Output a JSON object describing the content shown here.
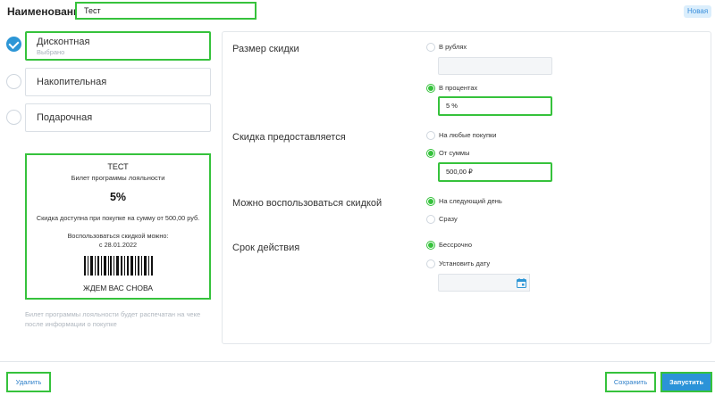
{
  "header": {
    "name_label": "Наименование",
    "name_value": "Тест",
    "status_badge": "Новая"
  },
  "types": [
    {
      "label": "Дисконтная",
      "sub": "Выбрано",
      "selected": true
    },
    {
      "label": "Накопительная",
      "selected": false
    },
    {
      "label": "Подарочная",
      "selected": false
    }
  ],
  "ticket": {
    "name": "ТЕСТ",
    "program": "Билет программы лояльности",
    "percent": "5%",
    "condition": "Скидка доступна при покупке на сумму от 500,00 руб.",
    "usable": "Воспользоваться скидкой можно:",
    "date": "с 28.01.2022",
    "footer": "ЖДЕМ ВАС СНОВА"
  },
  "print_note": "Билет программы лояльности будет распечатан на чеке после информации о покупке",
  "settings": {
    "discount_size": {
      "title": "Размер скидки",
      "opt_rub": "В рублях",
      "rub_value": "",
      "opt_percent": "В процентах",
      "percent_value": "5 %"
    },
    "provided": {
      "title": "Скидка предоставляется",
      "opt_any": "На любые покупки",
      "opt_sum": "От суммы",
      "sum_value": "500,00 ₽"
    },
    "use": {
      "title": "Можно воспользоваться скидкой",
      "opt_next": "На следующий день",
      "opt_now": "Сразу"
    },
    "validity": {
      "title": "Срок действия",
      "opt_unlimited": "Бессрочно",
      "opt_date": "Установить дату",
      "date_value": ""
    }
  },
  "footer": {
    "delete_label": "Удалить",
    "save_label": "Сохранить",
    "launch_label": "Запустить"
  },
  "icons": {
    "check": "check-icon",
    "calendar": "calendar-icon",
    "barcode": "barcode"
  },
  "colors": {
    "accent_blue": "#2b93d8",
    "highlight_green": "#36c23c",
    "badge_bg": "#dbeefc"
  }
}
